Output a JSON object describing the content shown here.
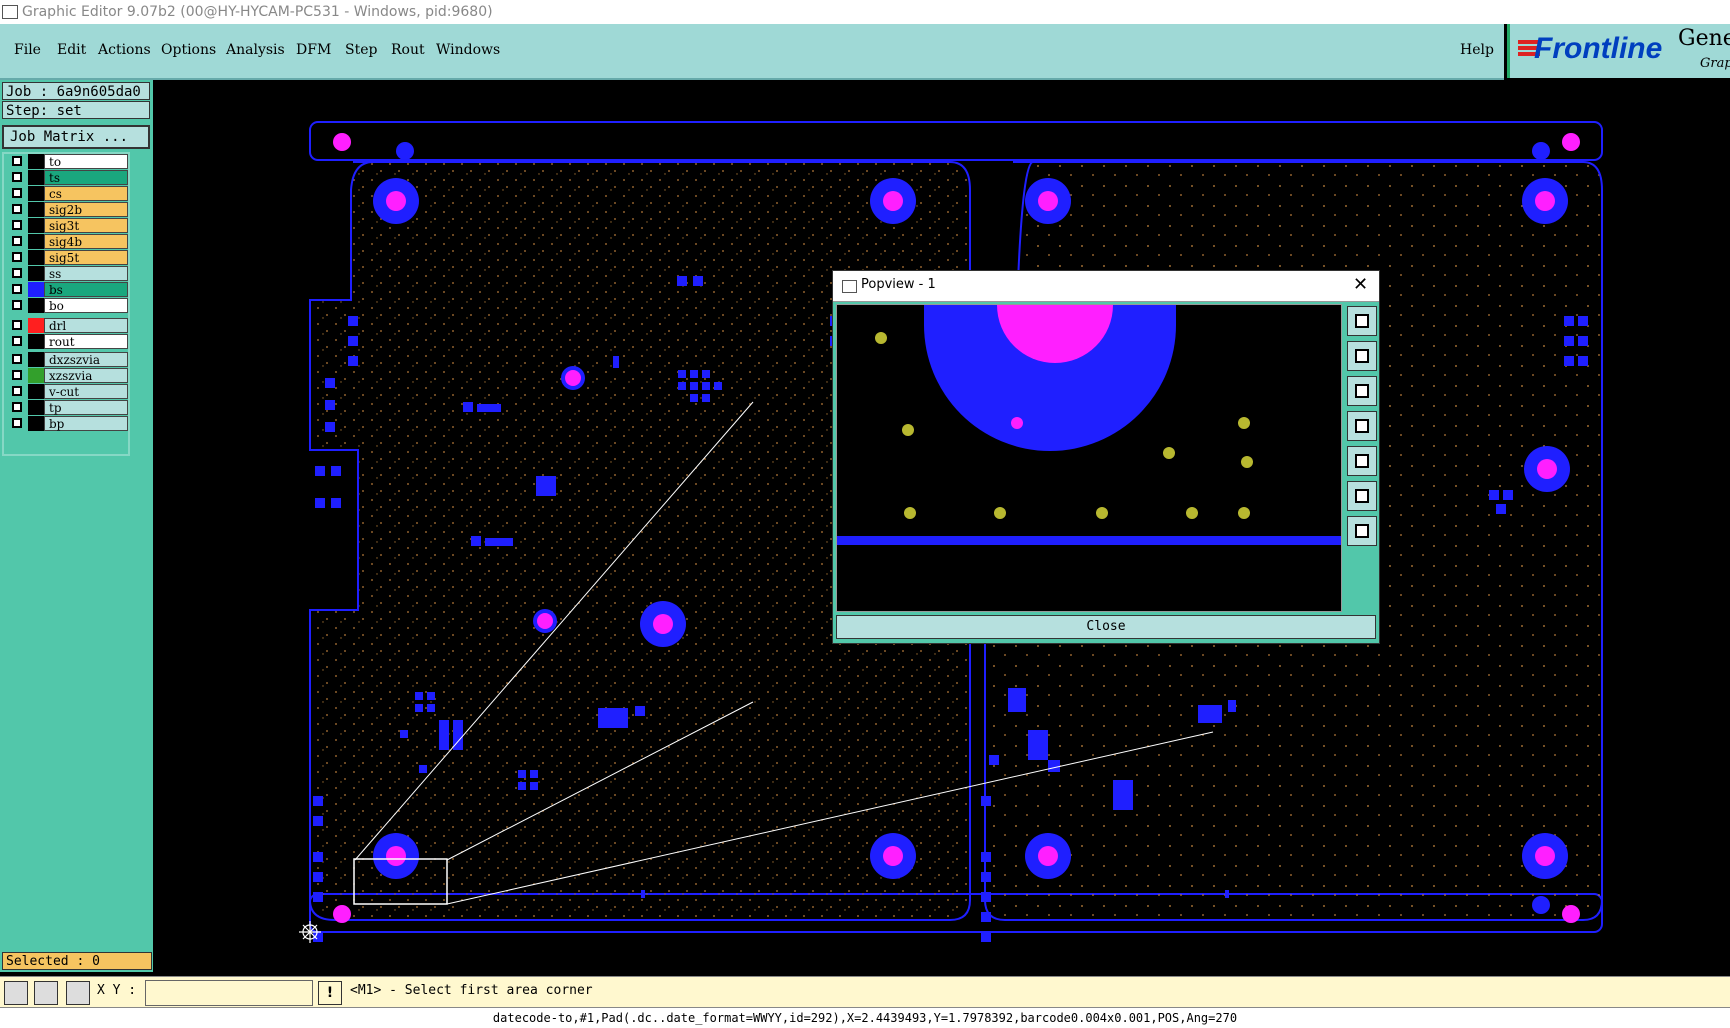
{
  "window": {
    "title": "Graphic Editor 9.07b2 (00@HY-HYCAM-PC531 - Windows, pid:9680)"
  },
  "menu": {
    "items": [
      "File",
      "Edit",
      "Actions",
      "Options",
      "Analysis",
      "DFM",
      "Step",
      "Rout",
      "Windows"
    ],
    "help": "Help"
  },
  "logo": {
    "brand": "Frontline",
    "product": "Gene",
    "subtitle": "Grap"
  },
  "job": {
    "job_label": "Job : 6a9n605da0",
    "step_label": "Step: set",
    "matrix_button": "Job Matrix ..."
  },
  "layers": [
    {
      "name": "to",
      "color": "#000000",
      "bg": "#ffffff"
    },
    {
      "name": "ts",
      "color": "#000000",
      "bg": "#1aa77e"
    },
    {
      "name": "cs",
      "color": "#000000",
      "bg": "#f6c460"
    },
    {
      "name": "sig2b",
      "color": "#000000",
      "bg": "#f6c460"
    },
    {
      "name": "sig3t",
      "color": "#000000",
      "bg": "#f6c460"
    },
    {
      "name": "sig4b",
      "color": "#000000",
      "bg": "#f6c460"
    },
    {
      "name": "sig5t",
      "color": "#000000",
      "bg": "#f6c460"
    },
    {
      "name": "ss",
      "color": "#000000",
      "bg": "#b6e0de"
    },
    {
      "name": "bs",
      "color": "#1f1fff",
      "bg": "#1aa77e"
    },
    {
      "name": "bo",
      "color": "#000000",
      "bg": "#ffffff"
    },
    {
      "name": "drl",
      "color": "#ff1f1f",
      "bg": "#b6e0de"
    },
    {
      "name": "rout",
      "color": "#000000",
      "bg": "#ffffff"
    },
    {
      "name": "dxzszvia",
      "color": "#000000",
      "bg": "#b6e0de"
    },
    {
      "name": "xzszvia",
      "color": "#33a02c",
      "bg": "#b6e0de"
    },
    {
      "name": "v-cut",
      "color": "#000000",
      "bg": "#b6e0de"
    },
    {
      "name": "tp",
      "color": "#000000",
      "bg": "#b6e0de"
    },
    {
      "name": "bp",
      "color": "#000000",
      "bg": "#b6e0de"
    }
  ],
  "selected": {
    "label": "Selected : 0"
  },
  "status": {
    "xy_label": "X Y :",
    "xy_value": "",
    "message": "<M1> - Select first area corner",
    "detail": "datecode-to,#1,Pad(.dc..date_format=WWYY,id=292),X=2.4439493,Y=1.7978392,barcode0.004x0.001,POS,Ang=270"
  },
  "popview": {
    "title": "Popview - 1",
    "close_label": "Close"
  },
  "colors": {
    "board_outline": "#1f1fff",
    "pad_magenta": "#ff1fff",
    "trace_dots": "#b87a3a",
    "panel_bg": "#52c7aa"
  }
}
